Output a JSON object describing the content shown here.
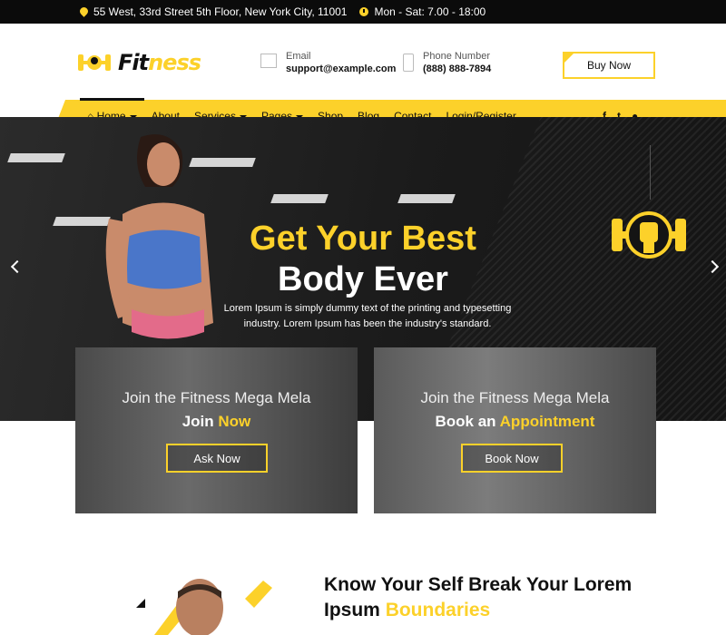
{
  "topbar": {
    "address": "55 West, 33rd Street 5th Floor, New York City, 11001",
    "hours": "Mon - Sat: 7.00 - 18:00"
  },
  "header": {
    "logo_fit": "Fit",
    "logo_ness": "ness",
    "email_label": "Email",
    "email_value": "support@example.com",
    "phone_label": "Phone Number",
    "phone_value": "(888) 888-7894",
    "buy_label": "Buy Now"
  },
  "nav": {
    "items": [
      {
        "label": "Home",
        "icon": "home-icon"
      },
      {
        "label": "About"
      },
      {
        "label": "Services"
      },
      {
        "label": "Pages"
      },
      {
        "label": "Shop"
      },
      {
        "label": "Blog"
      },
      {
        "label": "Contact"
      },
      {
        "label": "Login/Register"
      }
    ],
    "social": [
      "facebook-icon",
      "twitter-icon",
      "github-icon"
    ]
  },
  "hero": {
    "title_line1": "Get Your Best",
    "title_line2": "Body Ever",
    "text": "Lorem Ipsum is simply dummy text of the printing and typesetting industry. Lorem Ipsum has been the industry's standard."
  },
  "cards": [
    {
      "subtitle": "Join the Fitness Mega Mela",
      "title_a": "Join",
      "title_b": "Now",
      "button": "Ask Now"
    },
    {
      "subtitle": "Join the Fitness Mega Mela",
      "title_a": "Book an",
      "title_b": "Appointment",
      "button": "Book Now"
    }
  ],
  "about": {
    "title_line1": "Know Your Self Break Your Lorem",
    "title_line2a": "Ipsum",
    "title_line2b": "Boundaries"
  },
  "colors": {
    "accent": "#fcd12a",
    "dark": "#0b0b0b"
  }
}
